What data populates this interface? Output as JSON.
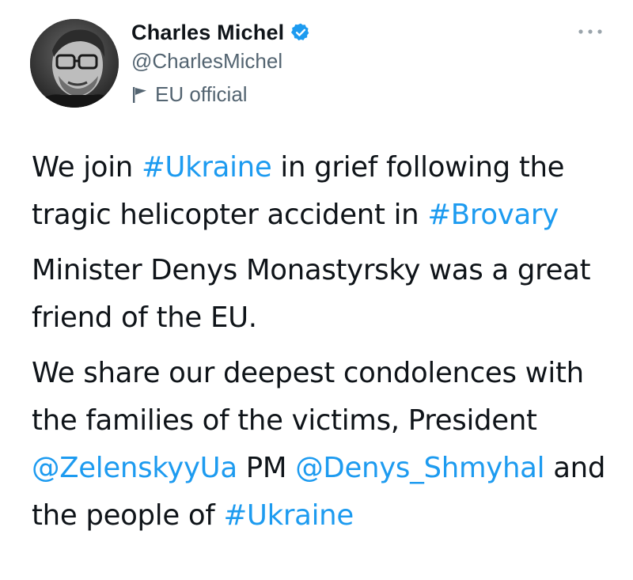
{
  "author": {
    "display_name": "Charles Michel",
    "handle": "@CharlesMichel",
    "affiliation": "EU official",
    "verified_icon": "verified-badge-icon",
    "affiliation_icon": "flag-icon"
  },
  "menu": {
    "more_icon": "more-horizontal-icon"
  },
  "tweet": {
    "p1_a": "We join ",
    "p1_tag1": "#Ukraine",
    "p1_b": " in grief following the tragic helicopter accident in ",
    "p1_tag2": "#Brovary",
    "p2": "Minister Denys Monastyrsky was a great friend of the EU.",
    "p3_a": "We share our deepest condolences with the families of the victims, President ",
    "p3_mention1": "@ZelenskyyUa",
    "p3_b": " PM ",
    "p3_mention2": "@Denys_Shmyhal",
    "p3_c": " and the people of ",
    "p3_tag": "#Ukraine"
  },
  "colors": {
    "link": "#1d9bf0",
    "text": "#0f1419",
    "secondary": "#536471"
  }
}
